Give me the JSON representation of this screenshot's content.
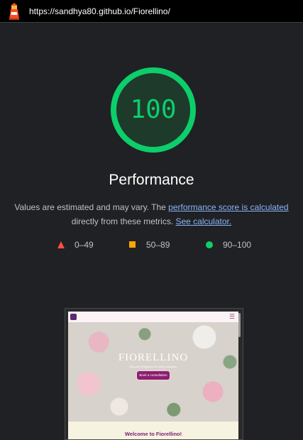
{
  "topbar": {
    "url": "https://sandhya80.github.io/Fiorellino/",
    "logo_icon": "lighthouse-icon"
  },
  "gauge": {
    "score": "100",
    "score_fraction": 1.0,
    "color": "#0cce6b"
  },
  "category": {
    "title": "Performance"
  },
  "description": {
    "text_before": "Values are estimated and may vary. The ",
    "link1": "performance score is calculated",
    "text_middle": " directly from these metrics. ",
    "link2": "See calculator."
  },
  "legend": [
    {
      "icon": "fail-triangle-icon",
      "label": "0–49",
      "color": "#ff4e42"
    },
    {
      "icon": "average-square-icon",
      "label": "50–89",
      "color": "#ffa400"
    },
    {
      "icon": "pass-circle-icon",
      "label": "90–100",
      "color": "#0cce6b"
    }
  ],
  "screenshot": {
    "site_title": "FIORELLINO",
    "tagline": "Discover Elegance for every occasion",
    "button_label": "Book a consultation",
    "menu_icon": "hamburger-icon",
    "welcome": "Welcome to Fiorellino!"
  }
}
